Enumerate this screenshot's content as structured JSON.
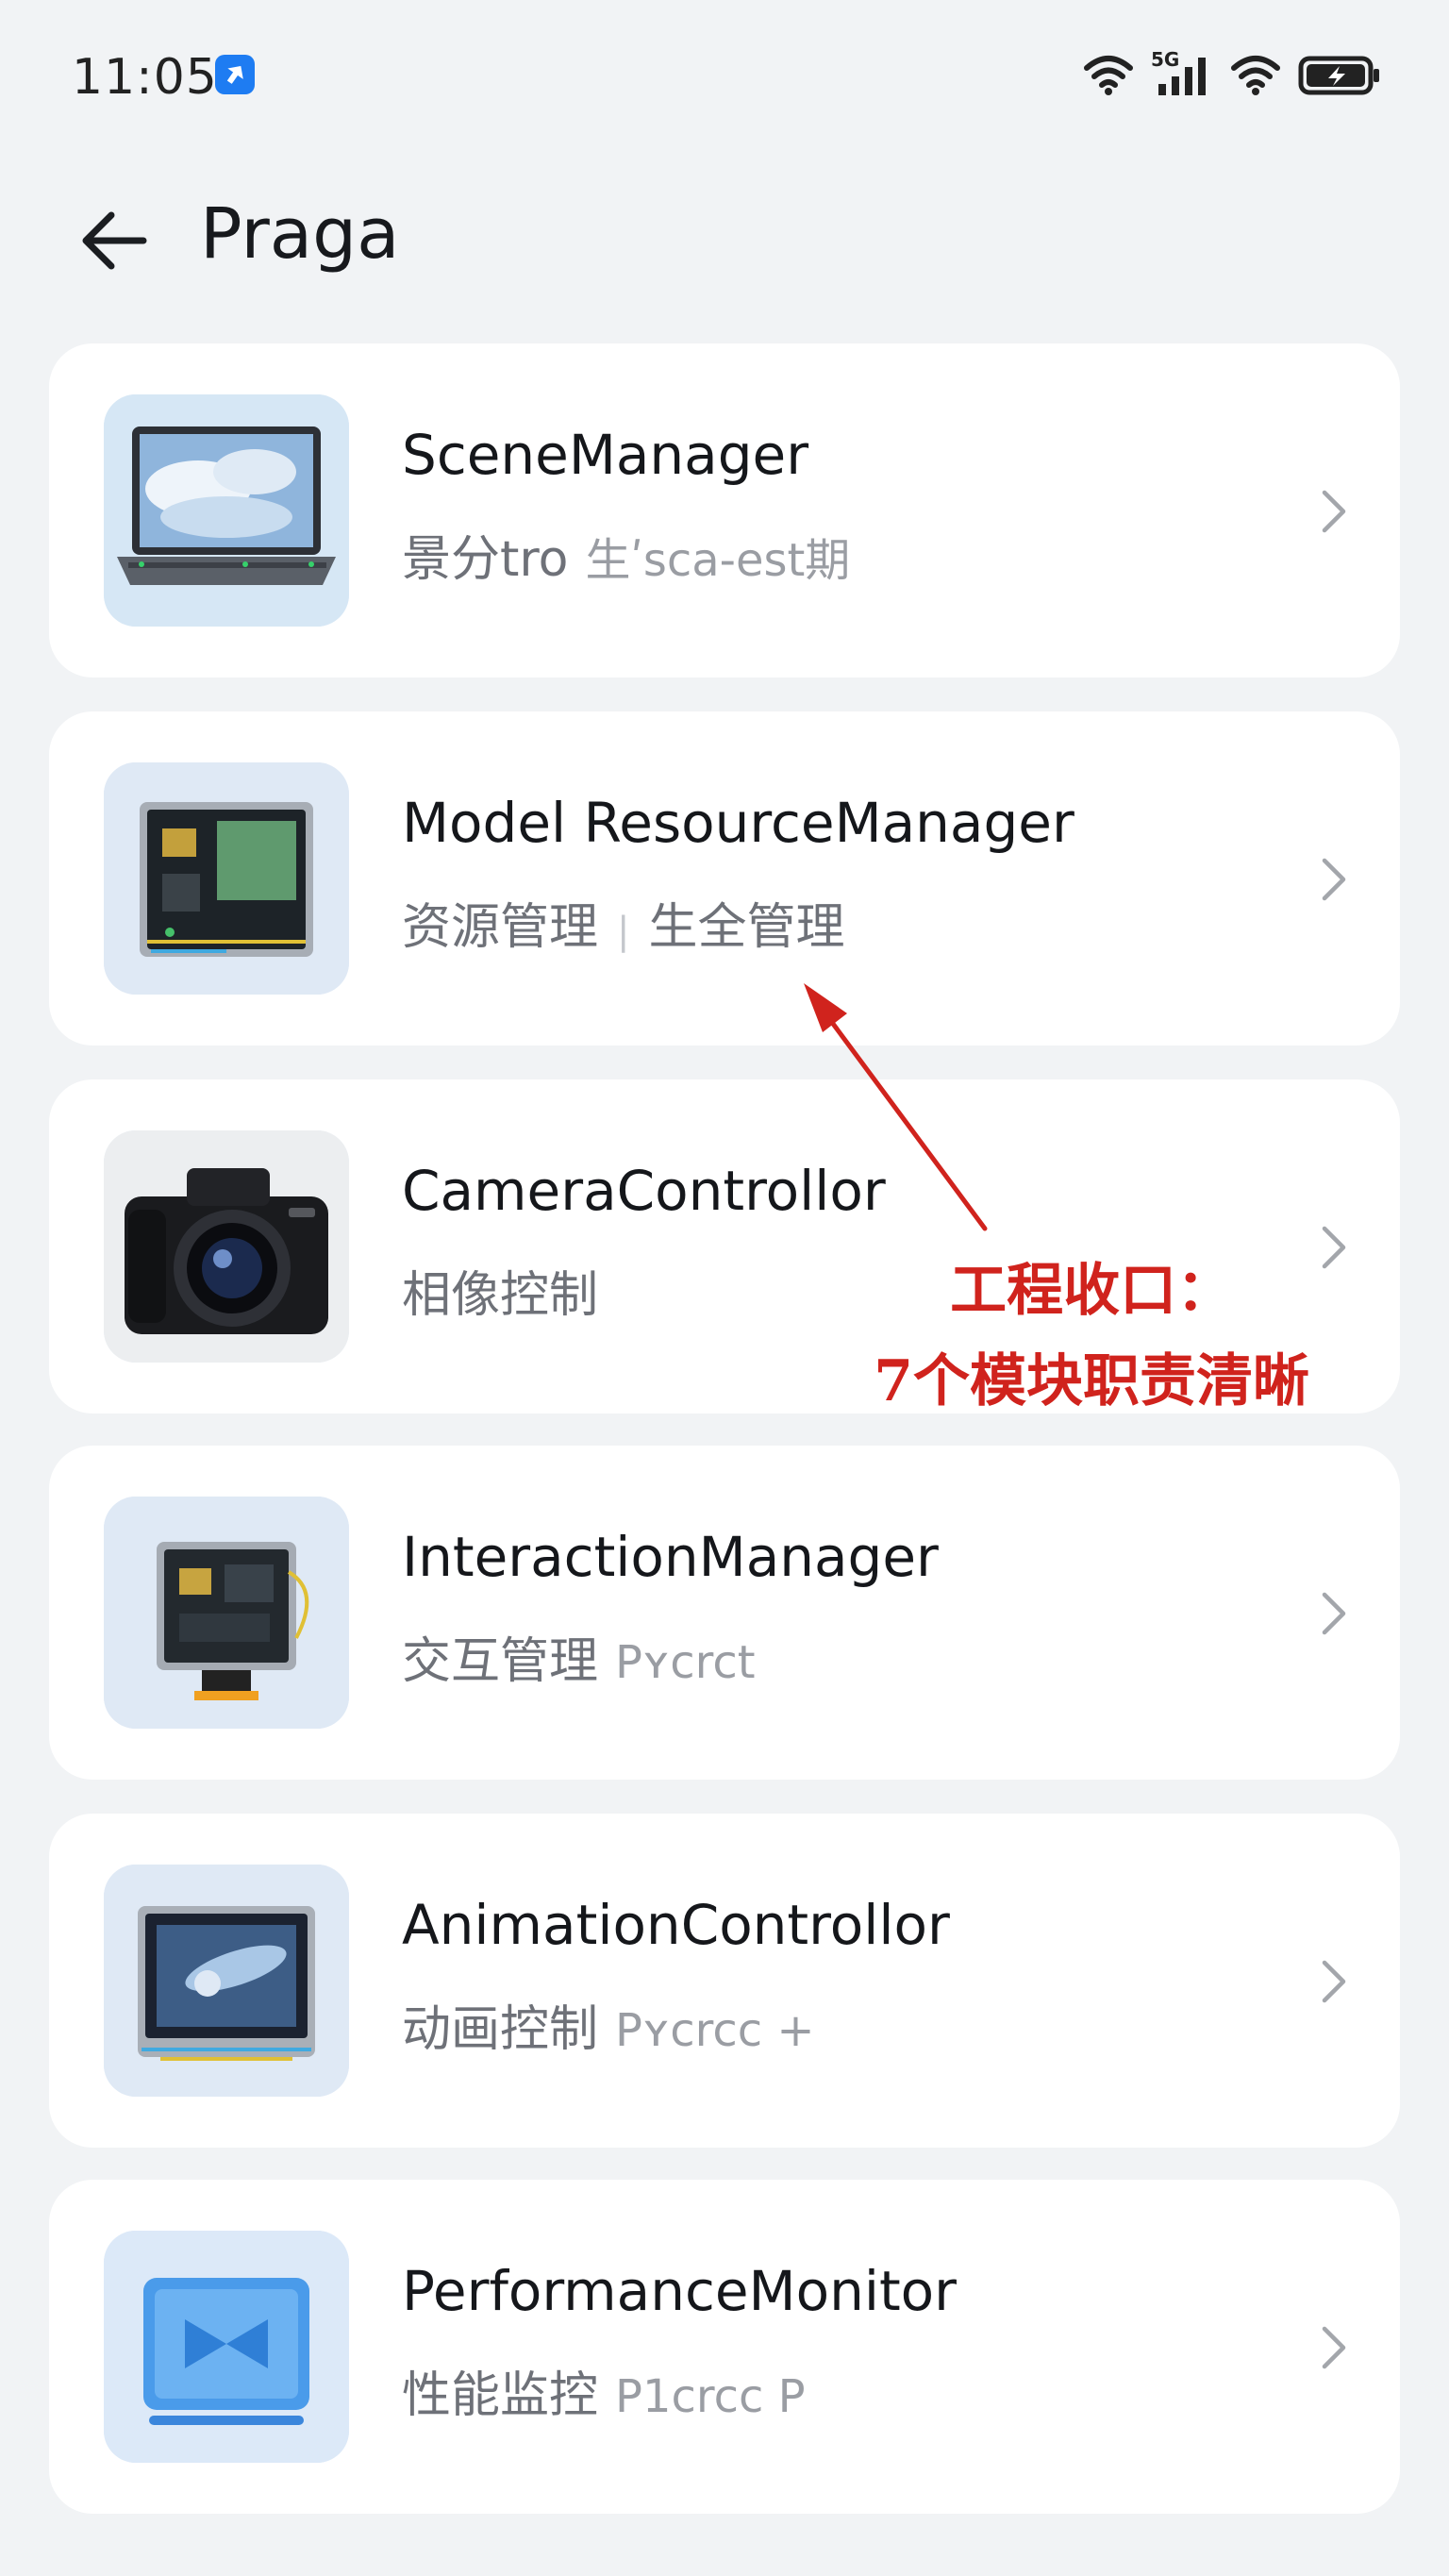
{
  "status_bar": {
    "time": "11:05",
    "network": "5G"
  },
  "header": {
    "title": "Praga"
  },
  "cards": [
    {
      "title": "SceneManager",
      "subtitle": "景分tro",
      "secondary": "生ʹsca-est期",
      "thumb": "laptop"
    },
    {
      "title": "Model ResourceManager",
      "subtitle": "资源管理",
      "secondary": "生全管理",
      "thumb": "circuit-board"
    },
    {
      "title": "CameraControllor",
      "subtitle": "相像控制",
      "secondary": "",
      "thumb": "camera"
    },
    {
      "title": "InteractionManager",
      "subtitle": "交互管理",
      "secondary": "Pʏcrct",
      "thumb": "circuit-module"
    },
    {
      "title": "AnimationControllor",
      "subtitle": "动画控制",
      "secondary": "Pʏcrcc +",
      "thumb": "display-module"
    },
    {
      "title": "PerformanceMonitor",
      "subtitle": "性能监控",
      "secondary": "P1crcc P",
      "thumb": "video-panel"
    }
  ],
  "annotation": {
    "line1": "工程收口：",
    "line2": "7个模块职责清晰",
    "color": "#d0231d"
  }
}
